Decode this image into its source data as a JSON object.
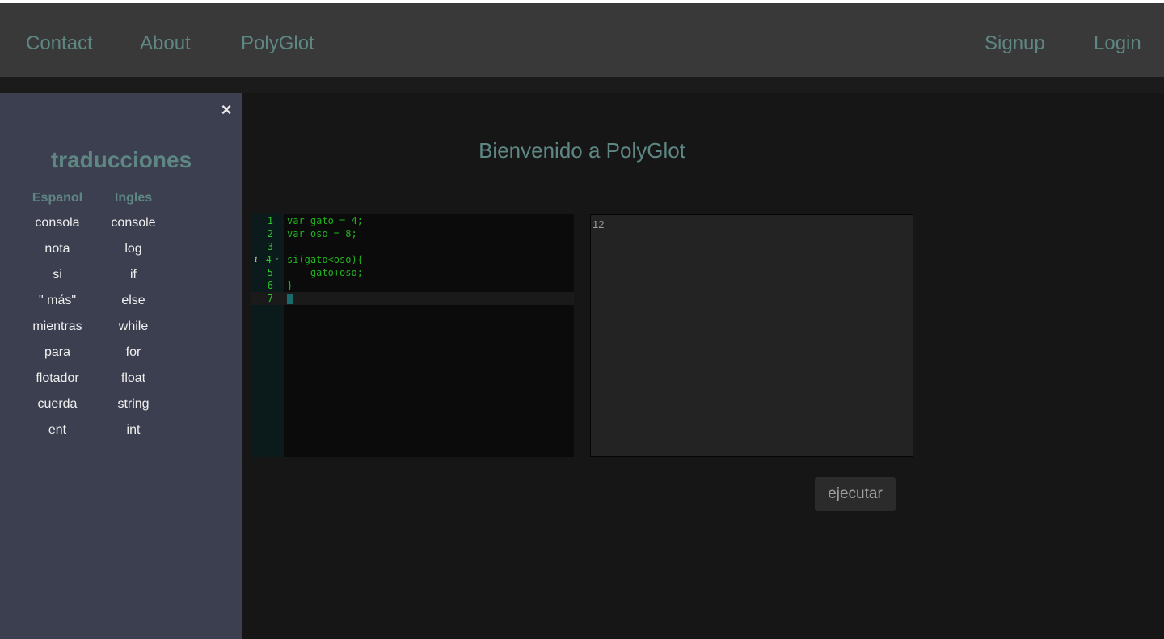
{
  "nav": {
    "contact": "Contact",
    "about": "About",
    "polyglot": "PolyGlot",
    "signup": "Signup",
    "login": "Login"
  },
  "sidebar": {
    "close_icon": "×",
    "title": "traducciones",
    "columns": [
      "Espanol",
      "Ingles"
    ],
    "spanish": [
      "consola",
      "nota",
      "si",
      "\" más\"",
      "mientras",
      "para",
      "flotador",
      "cuerda",
      "ent"
    ],
    "english": [
      "console",
      "log",
      "if",
      "else",
      "while",
      "for",
      "float",
      "string",
      "int"
    ]
  },
  "main": {
    "welcome": "Bienvenido a PolyGlot"
  },
  "editor": {
    "lines": [
      {
        "num": "1",
        "code": "var gato = 4;"
      },
      {
        "num": "2",
        "code": "var oso = 8;"
      },
      {
        "num": "3",
        "code": ""
      },
      {
        "num": "4",
        "code": "si(gato<oso){"
      },
      {
        "num": "5",
        "code": "    gato+oso;"
      },
      {
        "num": "6",
        "code": "}"
      },
      {
        "num": "7",
        "code": ""
      }
    ],
    "info_marker": "i",
    "fold_marker": "▾"
  },
  "output": {
    "text": "12"
  },
  "run_button": {
    "label": "ejecutar"
  },
  "colors": {
    "accent": "#5e8683",
    "sidebar_bg": "#3c3f4f",
    "topbar_bg": "#393939",
    "code_green": "#1fb41f"
  }
}
